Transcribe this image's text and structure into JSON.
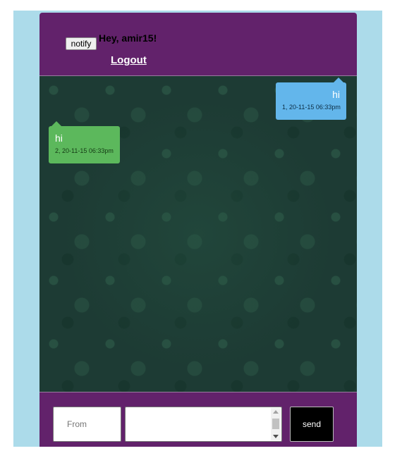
{
  "header": {
    "notify_label": "notify",
    "greeting": "Hey, amir15!",
    "logout_label": "Logout"
  },
  "messages": [
    {
      "side": "right",
      "text": "hi",
      "meta": "1, 20-11-15 06:33pm",
      "color": "#63b6eb"
    },
    {
      "side": "left",
      "text": "hi",
      "meta": "2, 20-11-15 06:33pm",
      "color": "#5cb85c"
    }
  ],
  "composer": {
    "from_placeholder": "From",
    "from_value": "",
    "message_value": "",
    "send_label": "send"
  },
  "colors": {
    "app_bg": "#62226b",
    "page_bg": "#acdbea",
    "chat_bg": "#1d3b34",
    "send_bg": "#000000"
  }
}
